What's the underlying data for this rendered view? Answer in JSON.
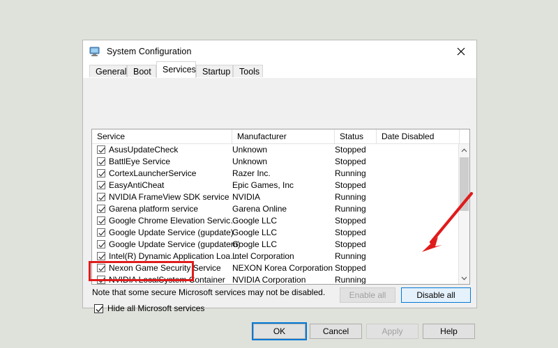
{
  "window": {
    "title": "System Configuration",
    "icon": "monitor-icon",
    "close_label": "✕"
  },
  "tabs": [
    {
      "label": "General",
      "active": false
    },
    {
      "label": "Boot",
      "active": false
    },
    {
      "label": "Services",
      "active": true
    },
    {
      "label": "Startup",
      "active": false
    },
    {
      "label": "Tools",
      "active": false
    }
  ],
  "list": {
    "columns": [
      "Service",
      "Manufacturer",
      "Status",
      "Date Disabled"
    ],
    "rows": [
      {
        "checked": true,
        "service": "AsusUpdateCheck",
        "manufacturer": "Unknown",
        "status": "Stopped",
        "date_disabled": ""
      },
      {
        "checked": true,
        "service": "BattlEye Service",
        "manufacturer": "Unknown",
        "status": "Stopped",
        "date_disabled": ""
      },
      {
        "checked": true,
        "service": "CortexLauncherService",
        "manufacturer": "Razer Inc.",
        "status": "Running",
        "date_disabled": ""
      },
      {
        "checked": true,
        "service": "EasyAntiCheat",
        "manufacturer": "Epic Games, Inc",
        "status": "Stopped",
        "date_disabled": ""
      },
      {
        "checked": true,
        "service": "NVIDIA FrameView SDK service",
        "manufacturer": "NVIDIA",
        "status": "Running",
        "date_disabled": ""
      },
      {
        "checked": true,
        "service": "Garena platform service",
        "manufacturer": "Garena Online",
        "status": "Running",
        "date_disabled": ""
      },
      {
        "checked": true,
        "service": "Google Chrome Elevation Servic…",
        "manufacturer": "Google LLC",
        "status": "Stopped",
        "date_disabled": ""
      },
      {
        "checked": true,
        "service": "Google Update Service (gupdate)",
        "manufacturer": "Google LLC",
        "status": "Stopped",
        "date_disabled": ""
      },
      {
        "checked": true,
        "service": "Google Update Service (gupdatem)",
        "manufacturer": "Google LLC",
        "status": "Stopped",
        "date_disabled": ""
      },
      {
        "checked": true,
        "service": "Intel(R) Dynamic Application Loa…",
        "manufacturer": "Intel Corporation",
        "status": "Running",
        "date_disabled": ""
      },
      {
        "checked": true,
        "service": "Nexon Game Security Service",
        "manufacturer": "NEXON Korea Corporation",
        "status": "Stopped",
        "date_disabled": ""
      },
      {
        "checked": true,
        "service": "NVIDIA LocalSystem Container",
        "manufacturer": "NVIDIA Corporation",
        "status": "Running",
        "date_disabled": ""
      }
    ],
    "scrollbar": {
      "up_arrow": "⌃",
      "down_arrow": "⌄"
    }
  },
  "footer": {
    "note": "Note that some secure Microsoft services may not be disabled.",
    "hide_microsoft_label": "Hide all Microsoft services",
    "hide_microsoft_checked": true,
    "enable_all_label": "Enable all",
    "disable_all_label": "Disable all"
  },
  "dialog_buttons": {
    "ok": "OK",
    "cancel": "Cancel",
    "apply": "Apply",
    "help": "Help"
  },
  "annotations": {
    "highlight_color": "#e01b1b",
    "box_target": "hide-all-microsoft-services-checkbox",
    "arrow_target": "disable-all-button"
  }
}
